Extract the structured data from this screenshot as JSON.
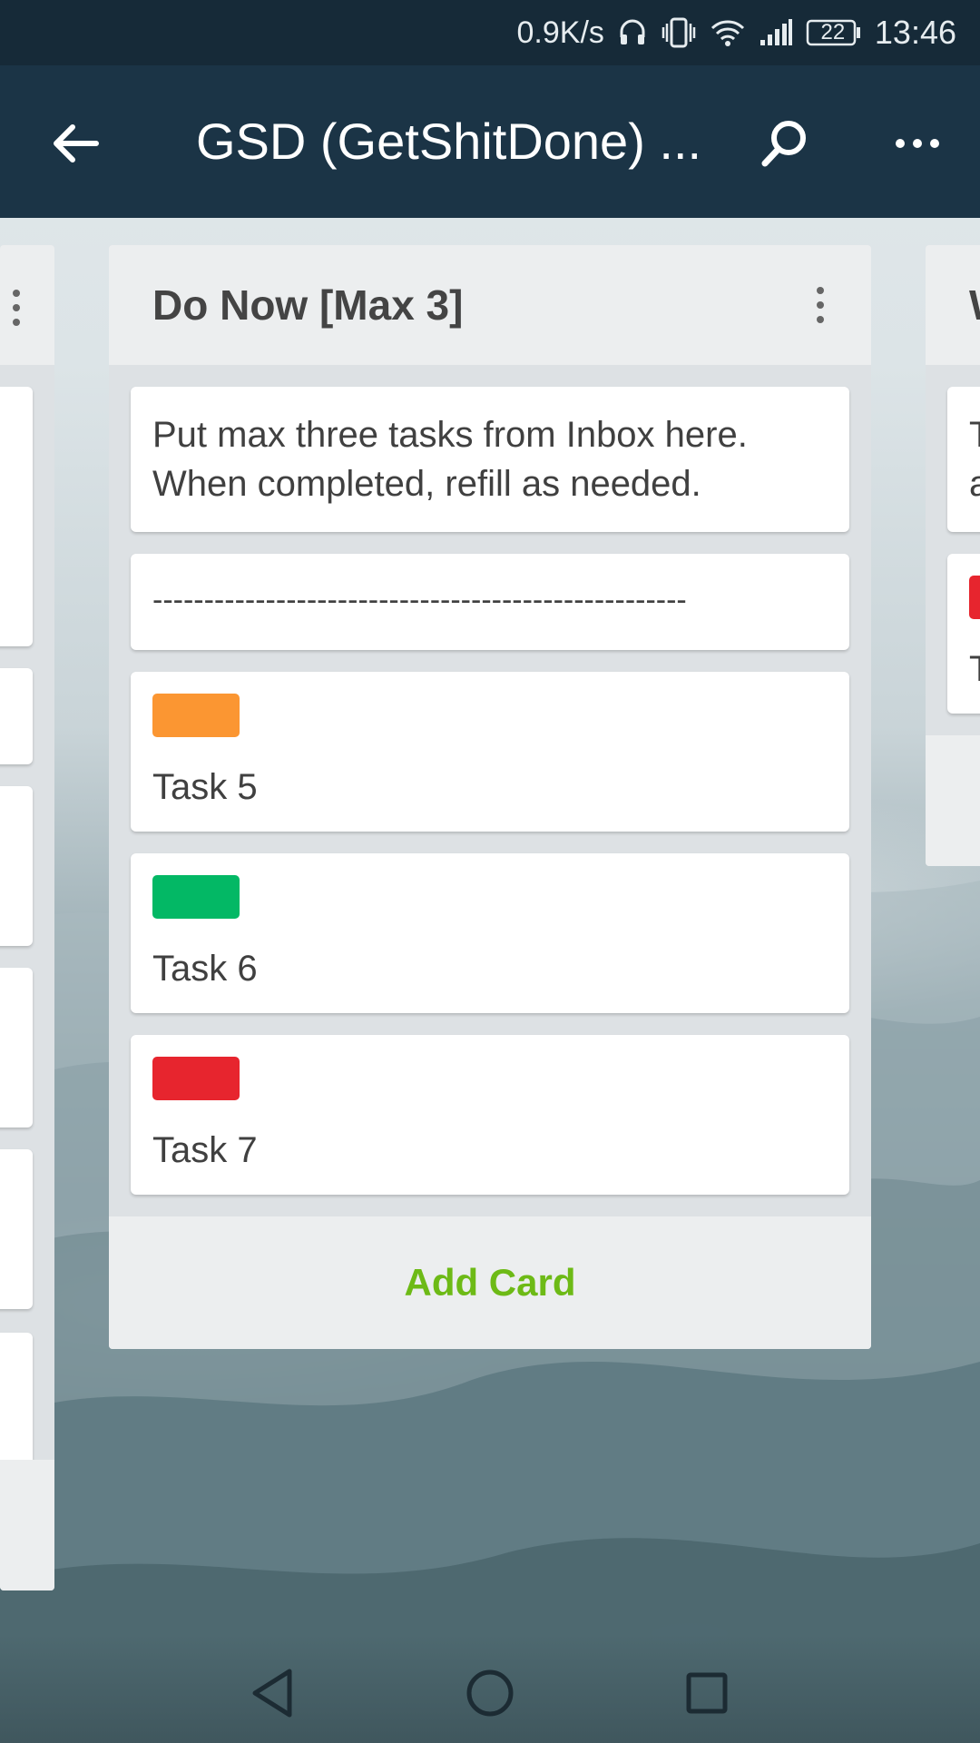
{
  "status_bar": {
    "network_speed": "0.9K/s",
    "battery_level": "22",
    "time": "13:46",
    "icons": [
      "headphones-icon",
      "vibrate-icon",
      "wifi-icon",
      "signal-icon",
      "battery-icon"
    ]
  },
  "app_bar": {
    "title": "GSD (GetShitDone) ...",
    "back_icon": "arrow-left-icon",
    "search_icon": "search-icon",
    "more_icon": "more-horizontal-icon"
  },
  "main_list": {
    "title": "Do Now [Max 3]",
    "cards": [
      {
        "text": "Put max three tasks from Inbox here.\nWhen completed, refill as needed."
      },
      {
        "text": "----------------------------------------------------"
      },
      {
        "label_color": "#fb9632",
        "text": "Task 5"
      },
      {
        "label_color": "#03b865",
        "text": "Task 6"
      },
      {
        "label_color": "#e7252e",
        "text": "Task 7"
      }
    ],
    "add_card_label": "Add Card"
  },
  "right_list": {
    "title_fragment": "W",
    "card_fragments": [
      "T",
      "a",
      "T"
    ],
    "label_color": "#e7252e"
  },
  "colors": {
    "status_bar": "#162a38",
    "app_bar": "#1b3446",
    "add_card": "#6dba16"
  }
}
